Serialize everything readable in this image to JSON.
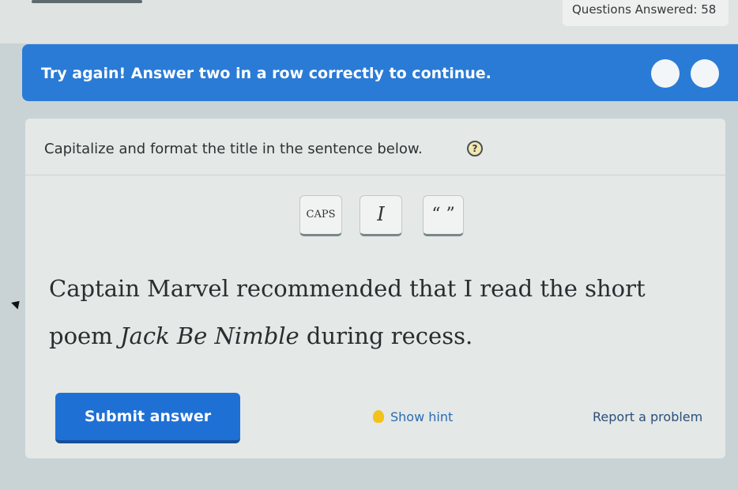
{
  "header": {
    "questions_answered_label": "Questions Answered:",
    "questions_answered_value": "58"
  },
  "banner": {
    "message": "Try again! Answer two in a row correctly to continue.",
    "streak_total": 2,
    "streak_completed": 0
  },
  "question": {
    "prompt": "Capitalize and format the title in the sentence below.",
    "help_icon_label": "?",
    "toolbar": {
      "caps_label": "CAPS",
      "italic_label": "I",
      "quotes_label": "“ ”"
    },
    "sentence_line1": "Captain Marvel recommended that I read the short",
    "sentence_line2_prefix": "poem ",
    "sentence_title": "Jack Be Nimble",
    "sentence_line2_suffix": " during recess."
  },
  "actions": {
    "submit_label": "Submit answer",
    "hint_label": "Show hint",
    "report_label": "Report a problem"
  },
  "colors": {
    "banner": "#2a7bd6",
    "submit": "#1f70d4",
    "hint_bulb": "#f2c21a",
    "link": "#2b6bb5"
  }
}
